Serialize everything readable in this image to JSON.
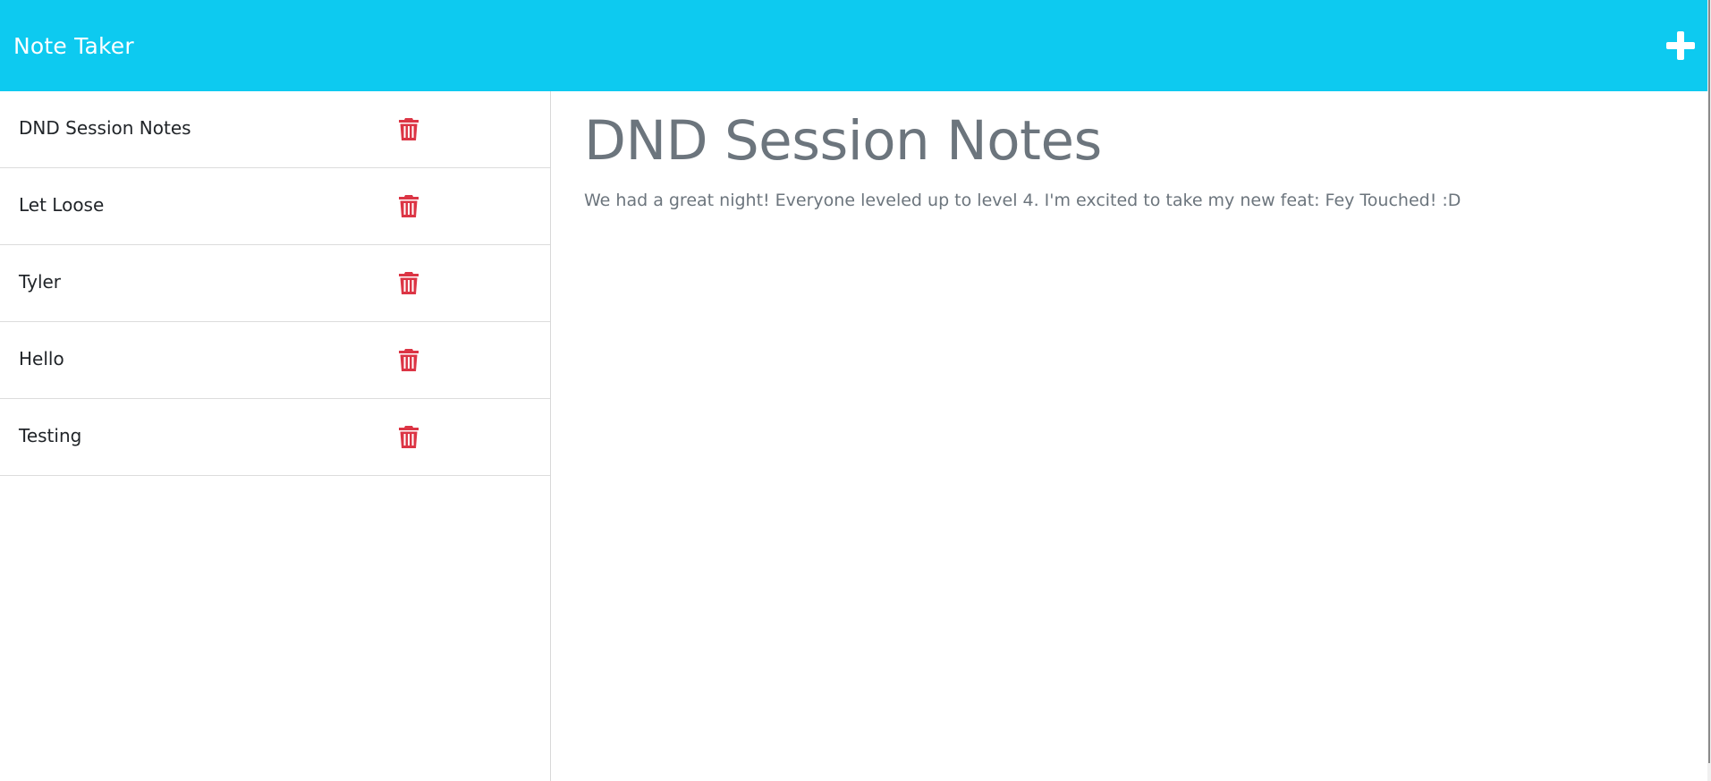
{
  "app": {
    "title": "Note Taker",
    "accent_color": "#0dcaf0",
    "delete_color": "#dc3545",
    "new_note_icon": "plus-icon"
  },
  "sidebar": {
    "notes": [
      {
        "title": "DND Session Notes",
        "icon": "trash-icon"
      },
      {
        "title": "Let Loose",
        "icon": "trash-icon"
      },
      {
        "title": "Tyler",
        "icon": "trash-icon"
      },
      {
        "title": "Hello",
        "icon": "trash-icon"
      },
      {
        "title": "Testing",
        "icon": "trash-icon"
      }
    ]
  },
  "main": {
    "note_title": "DND Session Notes",
    "note_text": "We had a great night! Everyone leveled up to level 4. I'm excited to take my new feat: Fey Touched! :D"
  }
}
